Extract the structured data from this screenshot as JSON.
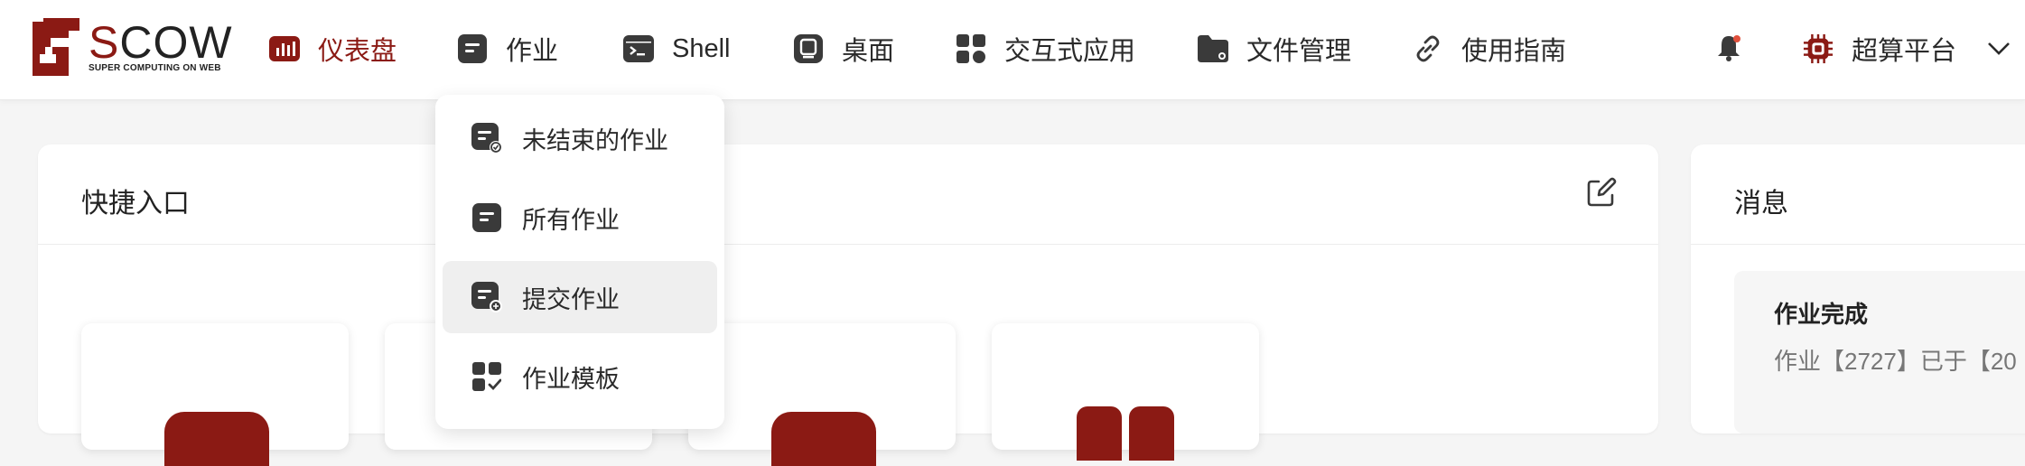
{
  "logo": {
    "brand_accent": "S",
    "brand_rest": "COW",
    "tagline": "SUPER COMPUTING ON WEB"
  },
  "nav": [
    {
      "label": "仪表盘",
      "icon": "dashboard-chart-icon",
      "active": true
    },
    {
      "label": "作业",
      "icon": "job-icon",
      "active": false
    },
    {
      "label": "Shell",
      "icon": "terminal-icon",
      "active": false
    },
    {
      "label": "桌面",
      "icon": "desktop-icon",
      "active": false
    },
    {
      "label": "交互式应用",
      "icon": "apps-grid-icon",
      "active": false
    },
    {
      "label": "文件管理",
      "icon": "folder-icon",
      "active": false
    },
    {
      "label": "使用指南",
      "icon": "link-icon",
      "active": false
    }
  ],
  "header_right": {
    "notification_icon": "bell-icon",
    "platform_label": "超算平台",
    "platform_icon": "chip-icon"
  },
  "jobs_dropdown": [
    {
      "label": "未结束的作业",
      "icon": "job-running-icon"
    },
    {
      "label": "所有作业",
      "icon": "job-icon"
    },
    {
      "label": "提交作业",
      "icon": "job-submit-icon",
      "hovered": true
    },
    {
      "label": "作业模板",
      "icon": "template-grid-icon"
    }
  ],
  "quick_entry": {
    "title": "快捷入口",
    "edit_icon": "edit-icon"
  },
  "messages": {
    "title": "消息",
    "items": [
      {
        "title": "作业完成",
        "body": "作业【2727】已于【20"
      }
    ]
  },
  "colors": {
    "accent": "#8b1a14",
    "icon_gray": "#3a3a3a",
    "background": "#f5f5f5"
  }
}
